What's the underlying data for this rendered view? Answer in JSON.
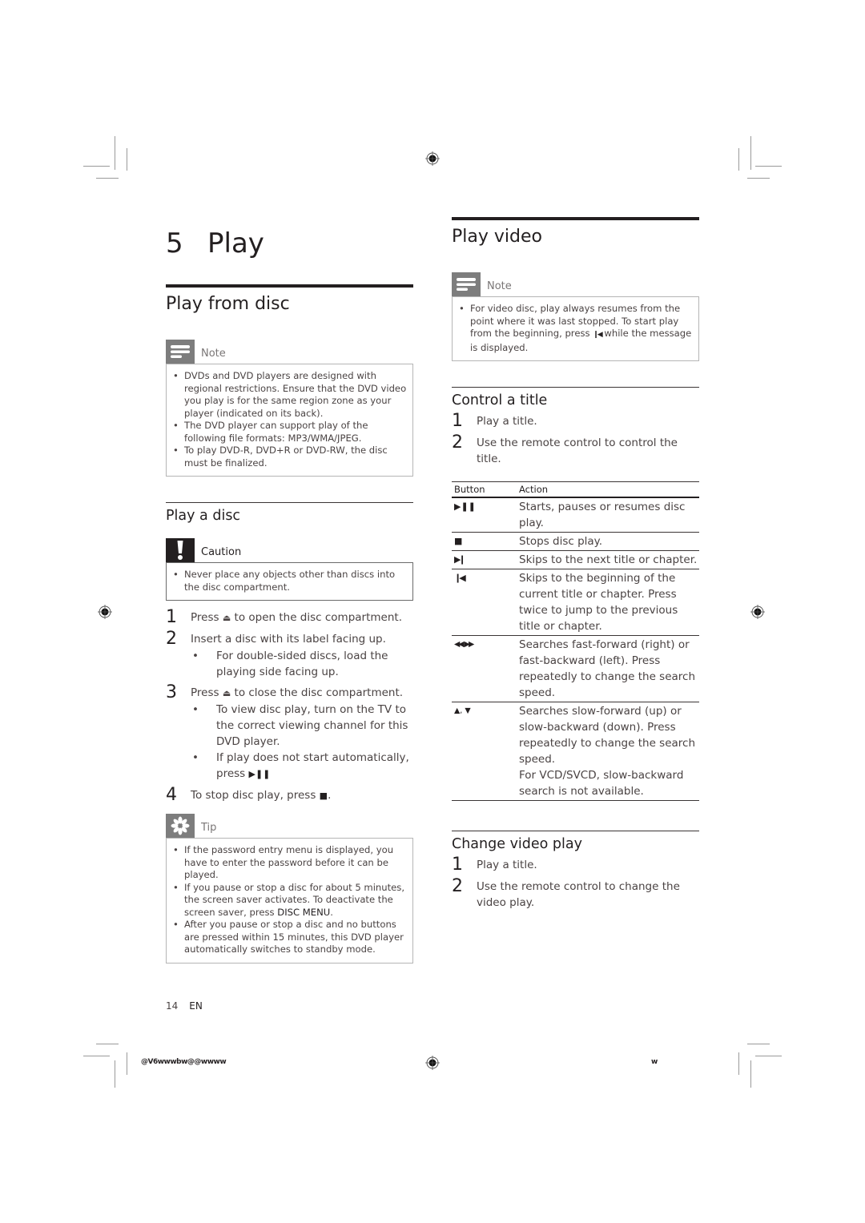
{
  "chapter": {
    "number": "5",
    "title": "Play"
  },
  "left": {
    "section_title": "Play from disc",
    "note": {
      "label": "Note",
      "icon": "note-lines-icon",
      "items": [
        "DVDs and DVD players are designed with regional restrictions. Ensure that the DVD video you play is for the same region zone as your player (indicated on its back).",
        "The DVD player can support play of the following file formats: MP3/WMA/JPEG.",
        "To play DVD-R, DVD+R or DVD-RW, the disc must be finalized."
      ]
    },
    "play_disc": {
      "title": "Play a disc",
      "caution": {
        "label": "Caution",
        "icon": "exclamation-icon",
        "items": [
          "Never place any objects other than discs into the disc compartment."
        ]
      },
      "steps": [
        {
          "num": "1",
          "before": "Press ",
          "icon": "eject-icon",
          "after": " to open the disc compartment."
        },
        {
          "num": "2",
          "text": "Insert a disc with its label facing up.",
          "bullets": [
            "For double-sided discs, load the playing side facing up."
          ]
        },
        {
          "num": "3",
          "before": "Press ",
          "icon": "eject-icon",
          "after": " to close the disc compartment.",
          "bullets": [
            "To view disc play, turn on the TV to the correct viewing channel for this DVD player.",
            "If play does not start automatically, press"
          ]
        },
        {
          "num": "4",
          "before": "To stop disc play, press ",
          "icon": "stop-icon",
          "after": "."
        }
      ],
      "tip": {
        "label": "Tip",
        "icon": "asterisk-tip-icon",
        "items": [
          "If the password entry menu is displayed, you have to enter the password before it can be played.",
          "If you pause or stop a disc for about 5 minutes, the screen saver activates. To deactivate the screen saver, press",
          "After you pause or stop a disc and no buttons are pressed within 15 minutes, this DVD player automatically switches to standby mode."
        ],
        "bold_key": "DISC MENU"
      }
    }
  },
  "right": {
    "section_title": "Play video",
    "note": {
      "label": "Note",
      "icon": "note-lines-icon",
      "before": "For video disc, play always resumes from the point where it was last stopped. To start play from the beginning, press ",
      "after": " while the message is displayed."
    },
    "control_title": {
      "title": "Control a title",
      "steps": [
        {
          "num": "1",
          "text": "Play a title."
        },
        {
          "num": "2",
          "text": "Use the remote control to control the title."
        }
      ],
      "table": {
        "headers": [
          "Button",
          "Action"
        ],
        "rows": [
          {
            "button": "▶❚❚",
            "icon": "play-pause-icon",
            "action": "Starts, pauses or resumes disc play."
          },
          {
            "button": "■",
            "icon": "stop-icon",
            "action": "Stops disc play."
          },
          {
            "button": "▶❙",
            "icon": "next-icon",
            "action": "Skips to the next title or chapter."
          },
          {
            "button": "❙◀",
            "icon": "previous-icon",
            "action": "Skips to the beginning of the current title or chapter. Press twice to jump to the previous title or chapter."
          },
          {
            "button": "◀◀, ▶▶",
            "icon": "rewind-forward-icon",
            "action": "Searches fast-forward (right) or fast-backward (left). Press repeatedly to change the search speed."
          },
          {
            "button": "▲, ▼",
            "icon": "up-down-icon",
            "action": "Searches slow-forward (up) or slow-backward (down). Press repeatedly to change the search speed.",
            "action2": "For VCD/SVCD, slow-backward search is not available."
          }
        ]
      }
    },
    "change_video": {
      "title": "Change video play",
      "steps": [
        {
          "num": "1",
          "text": "Play a title."
        },
        {
          "num": "2",
          "text": "Use the remote control to change the video play."
        }
      ]
    }
  },
  "footer": {
    "page": "14",
    "lang": "EN"
  },
  "print_code_left": "@V6wwwbw@@wwww",
  "print_code_right": "w",
  "glyphs": {
    "eject": "⏏",
    "stop": "■",
    "prev": "❙◀",
    "play_pause": "▶❚❚",
    "bullet": "•"
  }
}
